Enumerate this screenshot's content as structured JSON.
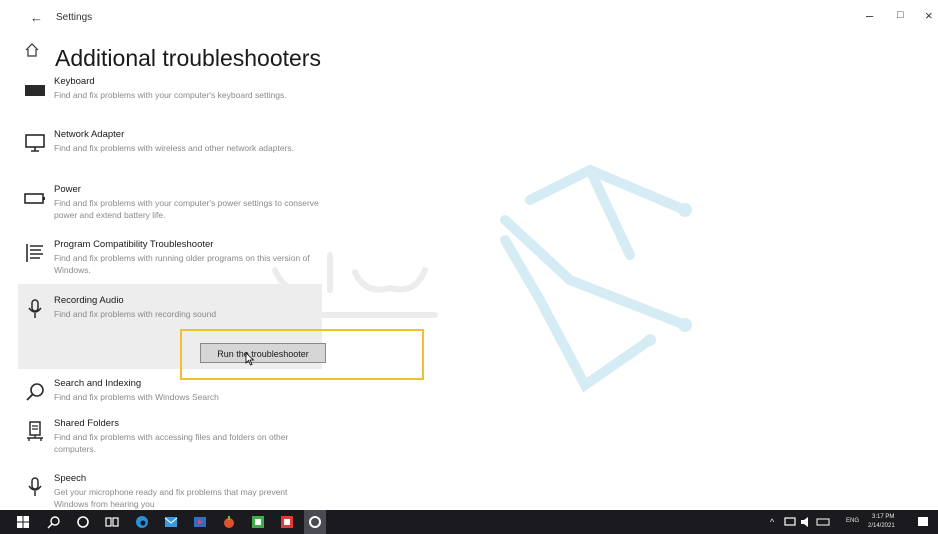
{
  "window": {
    "app_title": "Settings",
    "back_label": "←",
    "minimize": "–",
    "maximize": "□",
    "close": "×"
  },
  "page": {
    "title": "Additional troubleshooters"
  },
  "troubleshooters": [
    {
      "name": "Keyboard",
      "desc": "Find and fix problems with your computer's keyboard settings.",
      "icon": "keyboard-icon"
    },
    {
      "name": "Network Adapter",
      "desc": "Find and fix problems with wireless and other network adapters.",
      "icon": "monitor-icon"
    },
    {
      "name": "Power",
      "desc": "Find and fix problems with your computer's power settings to conserve power and extend battery life.",
      "icon": "battery-icon"
    },
    {
      "name": "Program Compatibility Troubleshooter",
      "desc": "Find and fix problems with running older programs on this version of Windows.",
      "icon": "list-icon"
    },
    {
      "name": "Recording Audio",
      "desc": "Find and fix problems with recording sound",
      "icon": "microphone-icon"
    },
    {
      "name": "Search and Indexing",
      "desc": "Find and fix problems with Windows Search",
      "icon": "search-icon"
    },
    {
      "name": "Shared Folders",
      "desc": "Find and fix problems with accessing files and folders on other computers.",
      "icon": "shared-folder-icon"
    },
    {
      "name": "Speech",
      "desc": "Get your microphone ready and fix problems that may prevent Windows from hearing you",
      "icon": "microphone-icon"
    }
  ],
  "run_button": "Run the troubleshooter",
  "taskbar": {
    "clock_time": "3:17 PM",
    "clock_date": "2/14/2021",
    "language": "ENG"
  },
  "colors": {
    "highlight_border": "#f0c030",
    "taskbar_bg": "#1b1b1f",
    "selected_bg": "#ededed"
  }
}
